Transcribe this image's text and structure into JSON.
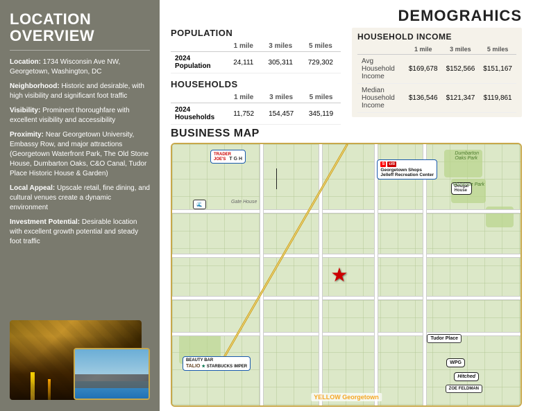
{
  "left": {
    "title": "LOCATION\nOVERVIEW",
    "location_label": "Location:",
    "location_value": "1734 Wisconsin Ave NW, Georgetown, Washington, DC",
    "neighborhood_label": "Neighborhood:",
    "neighborhood_value": "Historic and desirable, with high visibility and significant foot traffic",
    "visibility_label": "Visibility:",
    "visibility_value": "Prominent thoroughfare with excellent visibility and accessibility",
    "proximity_label": "Proximity:",
    "proximity_value": "Near Georgetown University, Embassy Row, and major attractions (Georgetown Waterfront Park, The Old Stone House, Dumbarton Oaks, C&O Canal, Tudor Place Historic House & Garden)",
    "local_label": "Local Appeal:",
    "local_value": "Upscale retail, fine dining, and cultural venues create a dynamic environment",
    "investment_label": "Investment Potential:",
    "investment_value": "Desirable location with excellent growth potential and steady foot traffic"
  },
  "demographics": {
    "header": "DEMOGRAHICS",
    "population": {
      "title": "POPULATION",
      "col1": "1 mile",
      "col2": "3 miles",
      "col3": "5 miles",
      "row_label": "2024\nPopulation",
      "val1": "24,111",
      "val2": "305,311",
      "val3": "729,302"
    },
    "households": {
      "title": "HOUSEHOLDS",
      "col1": "1 mile",
      "col2": "3 miles",
      "col3": "5 miles",
      "row_label": "2024\nHouseholds",
      "val1": "11,752",
      "val2": "154,457",
      "val3": "345,119"
    },
    "household_income": {
      "title": "HOUSEHOLD INCOME",
      "col1": "1 mile",
      "col2": "3 miles",
      "col3": "5 miles",
      "avg_label": "Avg\nHousehold\nIncome",
      "avg1": "$169,678",
      "avg2": "$152,566",
      "avg3": "$151,167",
      "med_label": "Median\nHousehold\nIncome",
      "med1": "$136,546",
      "med2": "$121,347",
      "med3": "$119,861"
    }
  },
  "business_map": {
    "title": "BUSINESS MAP",
    "star_label": "★",
    "geo_label": "YELLOW Georgetown",
    "businesses": [
      "TRADER JOE'S",
      "TGH",
      "Georgetown Shops",
      "Jelleff Recreation Center",
      "Dougal House",
      "WPG",
      "Hitched",
      "ZOE FELDMAN",
      "BEAUTY BAR",
      "TALIO",
      "STARBUCKS",
      "IMPER",
      "Tudor Place",
      "Dumbarton Oaks Park",
      "Montrose Park"
    ]
  }
}
